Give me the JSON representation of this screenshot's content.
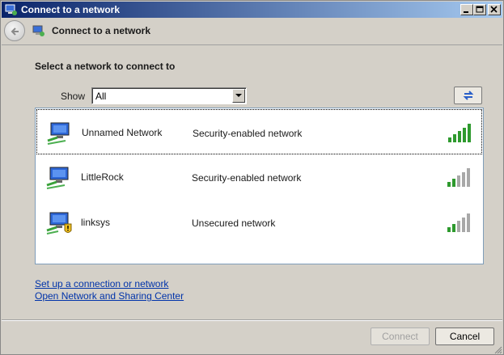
{
  "window": {
    "title": "Connect to a network",
    "controls": [
      "minimize-icon",
      "maximize-icon",
      "close-icon"
    ]
  },
  "nav": {
    "back_icon": "back-arrow-icon",
    "title": "Connect to a network"
  },
  "main": {
    "heading": "Select a network to connect to",
    "show_label": "Show",
    "show_selected": "All",
    "refresh_icon": "refresh-icon"
  },
  "networks": [
    {
      "name": "Unnamed Network",
      "security": "Security-enabled network",
      "signal_bars": 5,
      "selected": true,
      "secured": true
    },
    {
      "name": "LittleRock",
      "security": "Security-enabled network",
      "signal_bars": 2,
      "selected": false,
      "secured": true
    },
    {
      "name": "linksys",
      "security": "Unsecured network",
      "signal_bars": 2,
      "selected": false,
      "secured": false
    }
  ],
  "links": {
    "setup": "Set up a connection or network",
    "sharing_center": "Open Network and Sharing Center"
  },
  "buttons": {
    "connect": "Connect",
    "cancel": "Cancel"
  },
  "colors": {
    "titlebar_start": "#0a246a",
    "link": "#0033aa",
    "signal_active": "#2e9a2e",
    "signal_inactive": "#a8a8a8"
  }
}
